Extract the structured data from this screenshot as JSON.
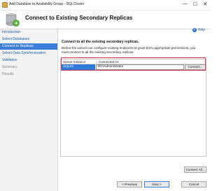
{
  "window": {
    "title": "Add Database to Availability Group - SQLCluster",
    "controls": [
      "—",
      "☐",
      "✕"
    ]
  },
  "header": {
    "heading": "Connect to Existing Secondary Replicas"
  },
  "sidebar": {
    "items": [
      {
        "label": "Introduction",
        "state": "link"
      },
      {
        "label": "Select Databases",
        "state": "link"
      },
      {
        "label": "Connect to Replicas",
        "state": "active"
      },
      {
        "label": "Select Data Synchronization",
        "state": "link"
      },
      {
        "label": "Validation",
        "state": "link"
      },
      {
        "label": "Summary",
        "state": "disabled"
      },
      {
        "label": "Results",
        "state": "disabled"
      }
    ]
  },
  "main": {
    "help_label": "Help",
    "lead": "Connect to all the existing secondary replicas.",
    "description": "Before the wizard can configure existing endpoints to grant them appropriate permissions, you must connect to all the existing secondary replicas.",
    "grid": {
      "columns": [
        "Server Instance",
        "Connected As"
      ],
      "rows": [
        {
          "server": "SQL03",
          "connected_as": "DC\\Administrator",
          "button": "Connect..."
        }
      ]
    },
    "connect_all_label": "Connect All..."
  },
  "footer": {
    "previous_label": "< Previous",
    "next_label": "Next >",
    "cancel_label": "Cancel"
  },
  "colors": {
    "accent": "#3b7dd8",
    "highlight": "#e0334c"
  }
}
